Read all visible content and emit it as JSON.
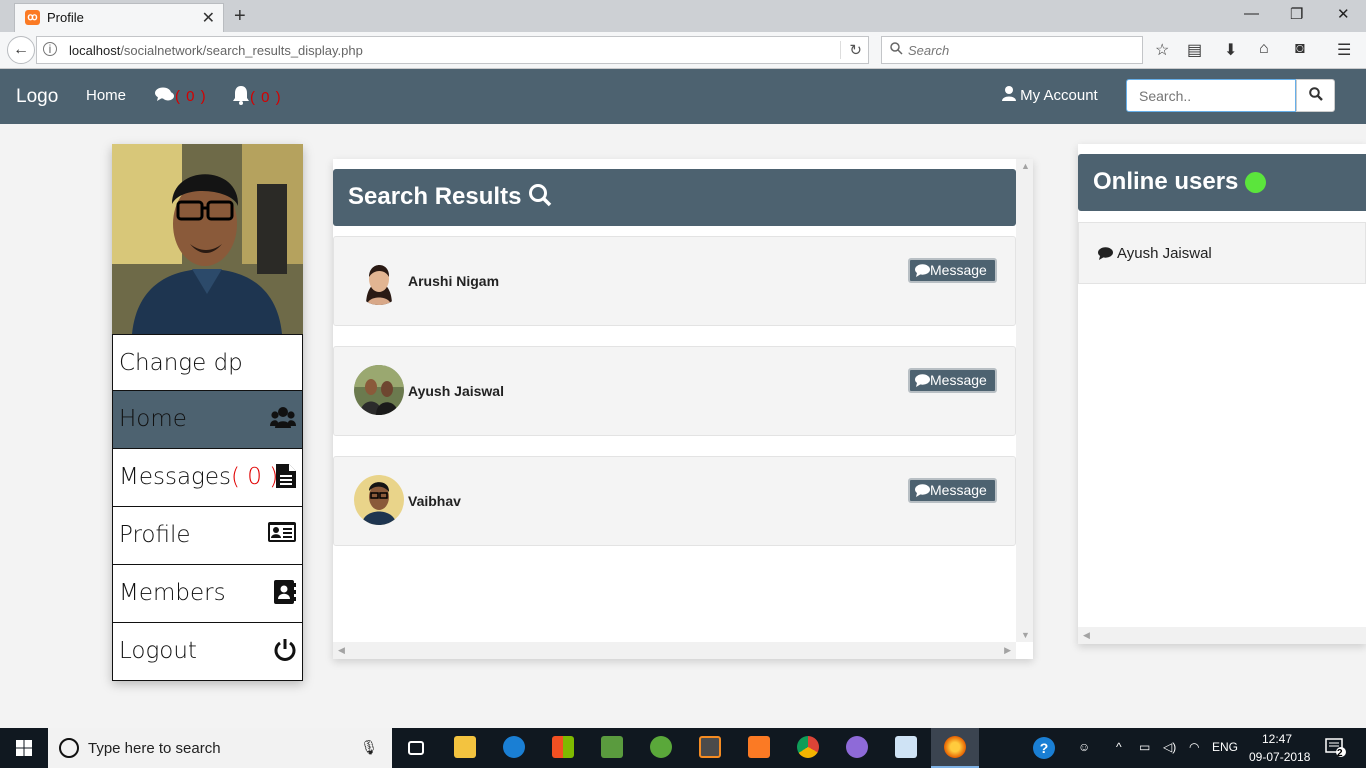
{
  "browser": {
    "tab_title": "Profile",
    "tab_close": "✕",
    "new_tab": "+",
    "url_host": "localhost",
    "url_path": "/socialnetwork/search_results_display.php",
    "search_placeholder": "Search",
    "win_minimize": "—",
    "win_restore": "❐",
    "win_close": "✕"
  },
  "site_nav": {
    "logo": "Logo",
    "home": "Home",
    "messages_count": "( 0 )",
    "notifications_count": "( 0 )",
    "my_account": "My Account",
    "search_placeholder": "Search.."
  },
  "sidebar": {
    "items": [
      {
        "label": "Change dp"
      },
      {
        "label": "Home"
      },
      {
        "label": "Messages",
        "count": "( 0 )"
      },
      {
        "label": "Profile"
      },
      {
        "label": "Members"
      },
      {
        "label": "Logout"
      }
    ]
  },
  "search_results": {
    "title": "Search Results",
    "results": [
      {
        "name": "Arushi Nigam",
        "button": "Message"
      },
      {
        "name": "Ayush Jaiswal",
        "button": "Message"
      },
      {
        "name": "Vaibhav",
        "button": "Message"
      }
    ]
  },
  "online_users": {
    "title": "Online users",
    "users": [
      {
        "name": "Ayush Jaiswal"
      }
    ]
  },
  "taskbar": {
    "search_placeholder": "Type here to search",
    "language": "ENG",
    "time": "12:47",
    "date": "09-07-2018",
    "notification_count": "2"
  }
}
